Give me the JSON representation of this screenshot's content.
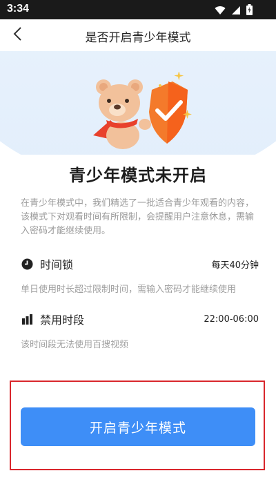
{
  "status_bar": {
    "time": "3:34"
  },
  "header": {
    "title": "是否开启青少年模式"
  },
  "main": {
    "headline": "青少年模式未开启",
    "description": "在青少年模式中，我们精选了一批适合青少年观看的内容，该模式下对观看时间有所限制，会提醒用户注意休息，需输入密码才能继续使用。",
    "features": [
      {
        "icon": "clock-icon",
        "title": "时间锁",
        "value": "每天40分钟",
        "desc": "单日使用时长超过限制时间，需输入密码才能继续使用"
      },
      {
        "icon": "bar-chart-icon",
        "title": "禁用时段",
        "value": "22:00-06:00",
        "desc": "该时间段无法使用百搜视频"
      }
    ],
    "button_label": "开启青少年模式"
  },
  "colors": {
    "accent": "#3e8ef7",
    "highlight": "#d9262c",
    "shield": "#f47a2b"
  }
}
